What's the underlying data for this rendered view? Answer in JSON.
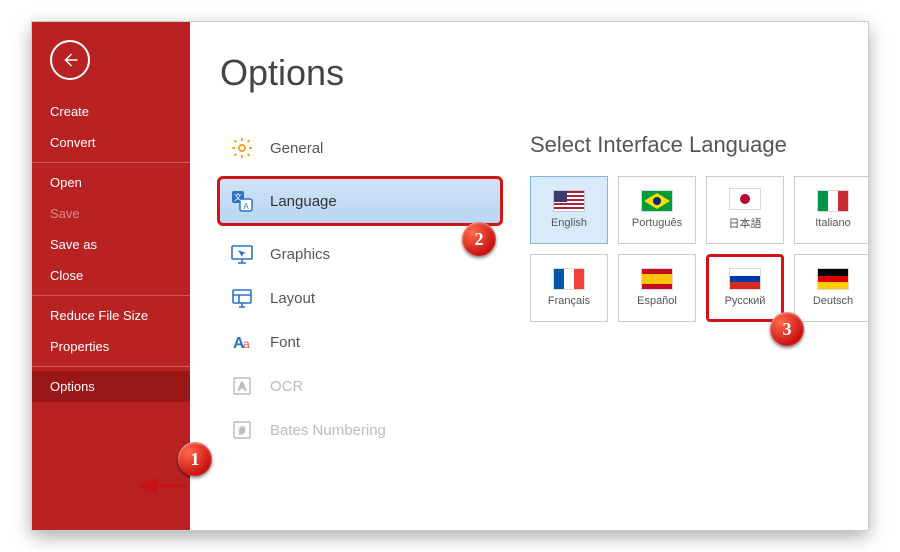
{
  "page": {
    "title": "Options"
  },
  "sidebar": {
    "groups": [
      {
        "items": [
          {
            "label": "Create"
          },
          {
            "label": "Convert"
          }
        ]
      },
      {
        "items": [
          {
            "label": "Open"
          },
          {
            "label": "Save",
            "disabled": true
          },
          {
            "label": "Save as"
          },
          {
            "label": "Close"
          }
        ]
      },
      {
        "items": [
          {
            "label": "Reduce File Size"
          },
          {
            "label": "Properties"
          }
        ]
      },
      {
        "items": [
          {
            "label": "Options",
            "selected": true
          }
        ]
      }
    ]
  },
  "options": {
    "items": [
      {
        "id": "general",
        "label": "General"
      },
      {
        "id": "language",
        "label": "Language",
        "selected": true
      },
      {
        "id": "graphics",
        "label": "Graphics"
      },
      {
        "id": "layout",
        "label": "Layout"
      },
      {
        "id": "font",
        "label": "Font"
      },
      {
        "id": "ocr",
        "label": "OCR",
        "disabled": true
      },
      {
        "id": "bates",
        "label": "Bates Numbering",
        "disabled": true
      }
    ]
  },
  "langpane": {
    "title": "Select Interface Language",
    "tiles": [
      {
        "id": "en",
        "label": "English",
        "selected": true
      },
      {
        "id": "pt",
        "label": "Português"
      },
      {
        "id": "ja",
        "label": "日本語"
      },
      {
        "id": "it",
        "label": "Italiano"
      },
      {
        "id": "fr",
        "label": "Français"
      },
      {
        "id": "es",
        "label": "Español"
      },
      {
        "id": "ru",
        "label": "Русский",
        "annot": true
      },
      {
        "id": "de",
        "label": "Deutsch"
      }
    ]
  },
  "annotations": {
    "badge1": "1",
    "badge2": "2",
    "badge3": "3"
  }
}
